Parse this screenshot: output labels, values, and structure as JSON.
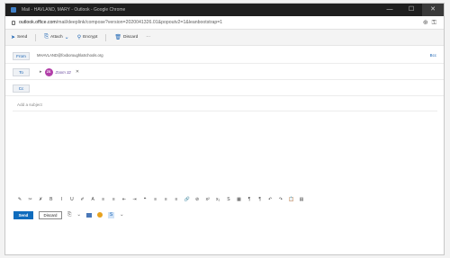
{
  "window": {
    "title": "Mail - HAVLAND, MARY - Outlook - Google Chrome",
    "controls": [
      "—",
      "☐",
      "✕"
    ]
  },
  "address": {
    "url_host": "outlook.office.com",
    "url_path": "/mail/deeplink/compose?version=2020041326.01&popoutv2=1&leanbootstrap=1"
  },
  "toolbar": {
    "send_label": "Send",
    "attach_label": "Attach",
    "encrypt_label": "Encrypt",
    "discard_label": "Discard",
    "more_label": "···"
  },
  "compose": {
    "from_label": "From",
    "from_value": "MHAVLAND@foxboroughlaSchools.org",
    "bcc_label": "Bcc",
    "to_label": "To",
    "to_recipient_initials": "ZS",
    "to_recipient_name": "Zoom 32",
    "cc_label": "Cc",
    "subject_placeholder": "Add a subject"
  },
  "format_icons": [
    "formatting-icon",
    "paint-icon",
    "clear-format-icon",
    "bold-icon",
    "italic-icon",
    "underline-icon",
    "highlight-icon",
    "font-color-icon",
    "bullets-icon",
    "numbering-icon",
    "decrease-indent-icon",
    "increase-indent-icon",
    "quote-icon",
    "align-left-icon",
    "align-center-icon",
    "align-right-icon",
    "link-icon",
    "unlink-icon",
    "superscript-icon",
    "subscript-icon",
    "strikethrough-icon",
    "table-icon",
    "ltr-icon",
    "rtl-icon",
    "undo-icon",
    "redo-icon",
    "paste-icon",
    "more-format-icon"
  ],
  "format_glyphs": [
    "✎",
    "✂",
    "✗",
    "B",
    "I",
    "U",
    "✐",
    "A",
    "≡",
    "≡",
    "⇤",
    "⇥",
    "❝",
    "≡",
    "≡",
    "≡",
    "🔗",
    "⊘",
    "x²",
    "x₂",
    "S",
    "▦",
    "¶",
    "¶",
    "↶",
    "↷",
    "📋",
    "▤"
  ],
  "actions": {
    "send_label": "Send",
    "discard_label": "Discard",
    "icons": [
      "attach-icon",
      "dropdown-icon",
      "image-icon",
      "emoji-icon",
      "ink-icon",
      "more-icon"
    ]
  },
  "colors": {
    "accent": "#0f6cbd",
    "avatar": "#b23fa9",
    "titlebar": "#1f1f1f"
  }
}
